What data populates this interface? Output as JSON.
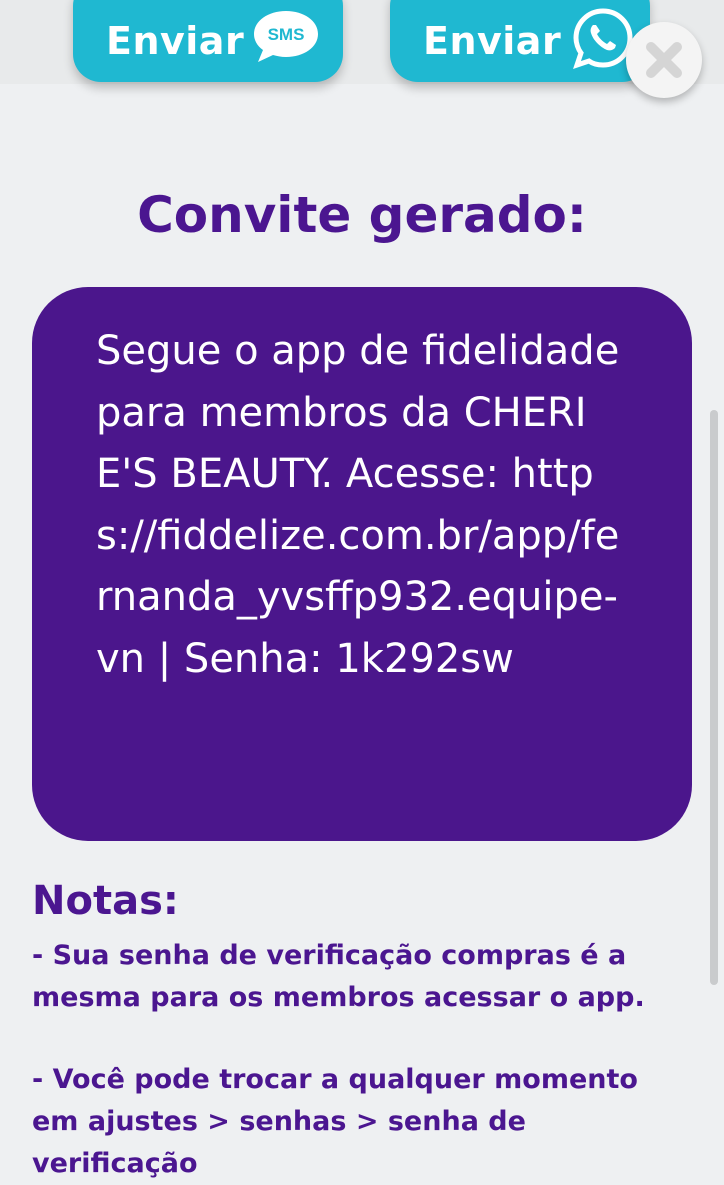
{
  "actions": {
    "send_sms_label": "Enviar",
    "send_sms_badge": "SMS",
    "send_whatsapp_label": "Enviar"
  },
  "title": "Convite gerado:",
  "invite_message": "Segue o app de fidelidade para membros da CHERIE'S BEAUTY. Acesse: https://fiddelize.com.br/app/fernanda_yvsffp932.equipe-vn | Senha: 1k292sw",
  "notes": {
    "title": "Notas:",
    "items": [
      "- Sua senha de verificação compras é a mesma para os membros acessar o app.",
      "- Você pode trocar a qualquer momento em ajustes > senhas > senha de verificação"
    ]
  },
  "colors": {
    "accent_purple": "#4b168c",
    "button_cyan": "#1fb8d1",
    "background": "#eef0f2"
  },
  "icons": [
    "sms-bubble-icon",
    "whatsapp-icon",
    "close-icon"
  ]
}
